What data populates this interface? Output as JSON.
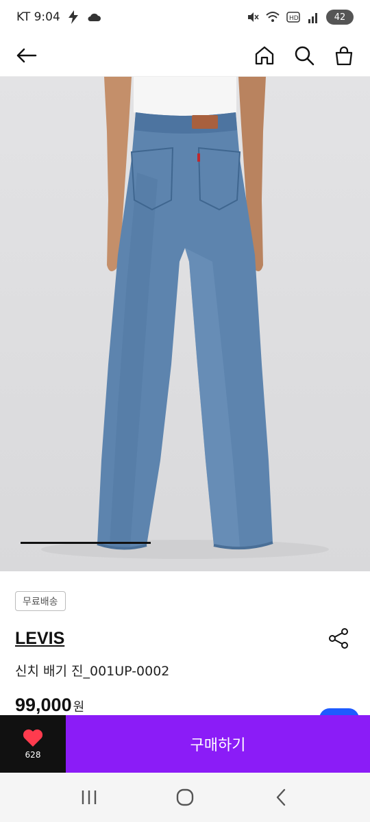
{
  "status_bar": {
    "carrier_time": "KT 9:04",
    "battery_level": "42",
    "icons": [
      "charging-bolt-icon",
      "cloud-icon",
      "mute-icon",
      "wifi-icon",
      "hd-icon",
      "signal-icon"
    ]
  },
  "app_bar": {
    "icons": [
      "back-arrow-icon",
      "home-icon",
      "search-icon",
      "shopping-bag-icon"
    ]
  },
  "product": {
    "badge": "무료배송",
    "brand": "LEVIS",
    "name": "신치 배기 진_001UP-0002",
    "price": "99,000",
    "currency": "원"
  },
  "action_bar": {
    "like_count": "628",
    "buy_label": "구매하기"
  },
  "colors": {
    "buy_button": "#8b1cf7",
    "like_background": "#111111",
    "heart": "#ff3b4e",
    "fab": "#1e5bff"
  }
}
